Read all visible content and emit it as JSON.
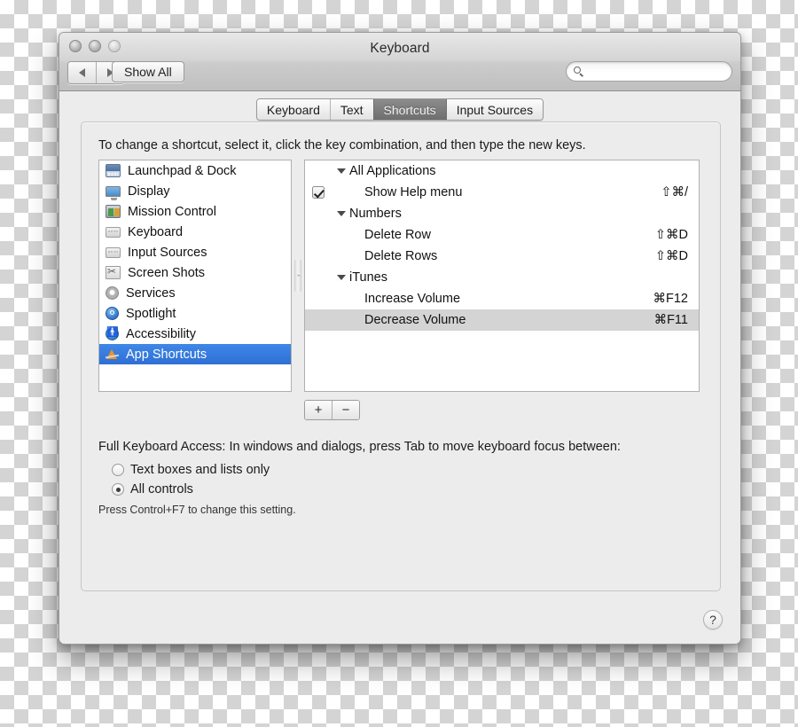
{
  "window": {
    "title": "Keyboard",
    "traffic_lights": [
      "close-button",
      "minimize-button",
      "zoom-button"
    ]
  },
  "toolbar": {
    "back_label": "◀",
    "forward_label": "▶",
    "show_all_label": "Show All",
    "search": {
      "value": "",
      "placeholder": "",
      "icon": "search-icon"
    }
  },
  "tabs": [
    {
      "label": "Keyboard",
      "active": false
    },
    {
      "label": "Text",
      "active": false
    },
    {
      "label": "Shortcuts",
      "active": true
    },
    {
      "label": "Input Sources",
      "active": false
    }
  ],
  "instruction": "To change a shortcut, select it, click the key combination, and then type the new keys.",
  "sidebar": {
    "items": [
      {
        "label": "Launchpad & Dock",
        "icon": "launchpad-dock-icon",
        "selected": false
      },
      {
        "label": "Display",
        "icon": "display-icon",
        "selected": false
      },
      {
        "label": "Mission Control",
        "icon": "mission-control-icon",
        "selected": false
      },
      {
        "label": "Keyboard",
        "icon": "keyboard-icon",
        "selected": false
      },
      {
        "label": "Input Sources",
        "icon": "input-sources-icon",
        "selected": false
      },
      {
        "label": "Screen Shots",
        "icon": "screen-shots-icon",
        "selected": false
      },
      {
        "label": "Services",
        "icon": "services-gear-icon",
        "selected": false
      },
      {
        "label": "Spotlight",
        "icon": "spotlight-icon",
        "selected": false
      },
      {
        "label": "Accessibility",
        "icon": "accessibility-icon",
        "selected": false
      },
      {
        "label": "App Shortcuts",
        "icon": "app-shortcuts-icon",
        "selected": true
      }
    ]
  },
  "shortcuts": {
    "rows": [
      {
        "type": "group",
        "label": "All Applications",
        "shortcut": "",
        "checkbox": null,
        "selected": false
      },
      {
        "type": "item",
        "label": "Show Help menu",
        "shortcut": "⇧⌘/",
        "checkbox": true,
        "selected": false
      },
      {
        "type": "group",
        "label": "Numbers",
        "shortcut": "",
        "checkbox": null,
        "selected": false
      },
      {
        "type": "item",
        "label": "Delete Row",
        "shortcut": "⇧⌘D",
        "checkbox": null,
        "selected": false
      },
      {
        "type": "item",
        "label": "Delete Rows",
        "shortcut": "⇧⌘D",
        "checkbox": null,
        "selected": false
      },
      {
        "type": "group",
        "label": "iTunes",
        "shortcut": "",
        "checkbox": null,
        "selected": false
      },
      {
        "type": "item",
        "label": "Increase Volume",
        "shortcut": "⌘F12",
        "checkbox": null,
        "selected": false
      },
      {
        "type": "item",
        "label": "Decrease Volume",
        "shortcut": "⌘F11",
        "checkbox": null,
        "selected": true
      }
    ]
  },
  "list_buttons": {
    "add_label": "+",
    "remove_label": "−"
  },
  "full_keyboard_access": {
    "title": "Full Keyboard Access: In windows and dialogs, press Tab to move keyboard focus between:",
    "options": [
      {
        "label": "Text boxes and lists only",
        "selected": false
      },
      {
        "label": "All controls",
        "selected": true
      }
    ],
    "note": "Press Control+F7 to change this setting."
  },
  "help_button": {
    "label": "?"
  },
  "colors": {
    "selection_blue": "#3f87e8",
    "inactive_selection": "#d4d4d4",
    "active_tab": "#7f7f7f",
    "window_bg": "#ececec"
  }
}
